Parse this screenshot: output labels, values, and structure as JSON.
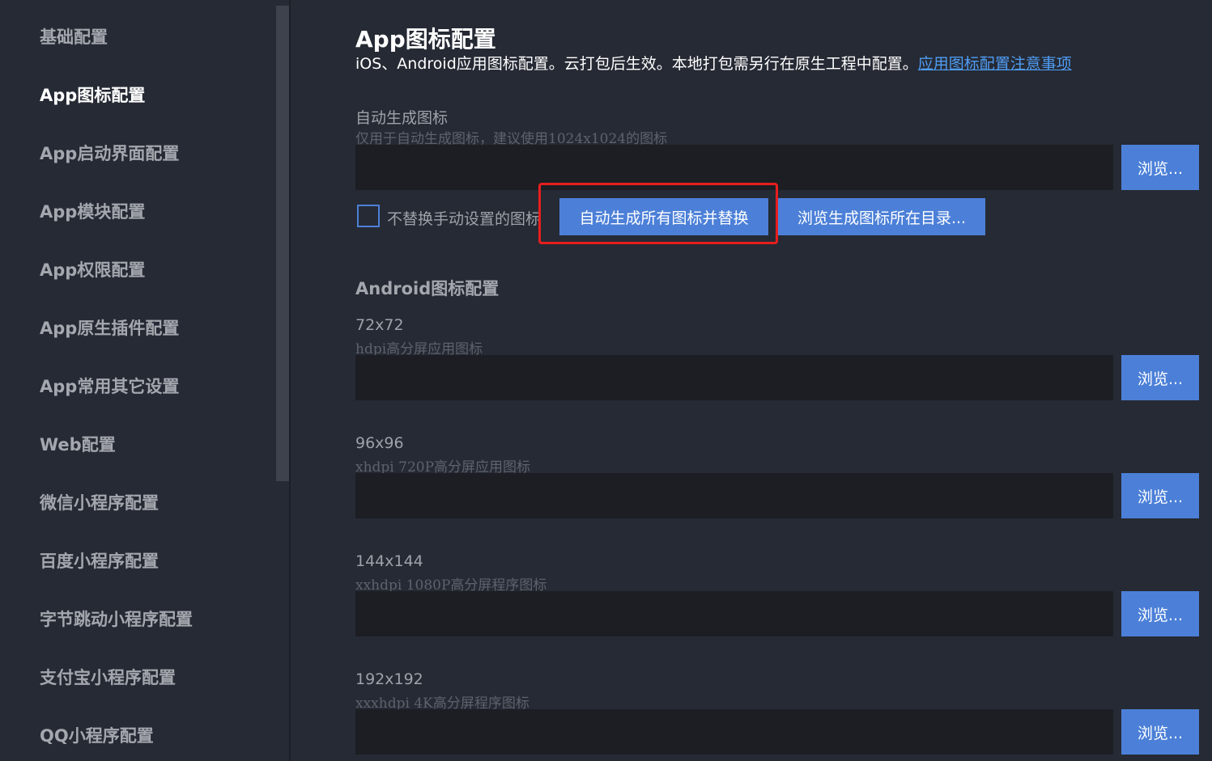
{
  "sidebar": {
    "items": [
      {
        "label": "基础配置",
        "active": false
      },
      {
        "label": "App图标配置",
        "active": true
      },
      {
        "label": "App启动界面配置",
        "active": false
      },
      {
        "label": "App模块配置",
        "active": false
      },
      {
        "label": "App权限配置",
        "active": false
      },
      {
        "label": "App原生插件配置",
        "active": false
      },
      {
        "label": "App常用其它设置",
        "active": false
      },
      {
        "label": "Web配置",
        "active": false
      },
      {
        "label": "微信小程序配置",
        "active": false
      },
      {
        "label": "百度小程序配置",
        "active": false
      },
      {
        "label": "字节跳动小程序配置",
        "active": false
      },
      {
        "label": "支付宝小程序配置",
        "active": false
      },
      {
        "label": "QQ小程序配置",
        "active": false
      }
    ]
  },
  "main": {
    "title": "App图标配置",
    "description": "iOS、Android应用图标配置。云打包后生效。本地打包需另行在原生工程中配置。",
    "description_link": "应用图标配置注意事项",
    "auto": {
      "label": "自动生成图标",
      "hint": "仅用于自动生成图标，建议使用1024x1024的图标",
      "value": "",
      "browse_label": "浏览...",
      "checkbox_label": "不替换手动设置的图标",
      "checkbox_checked": false,
      "generate_label": "自动生成所有图标并替换",
      "open_dir_label": "浏览生成图标所在目录..."
    },
    "android": {
      "section_title": "Android图标配置",
      "fields": [
        {
          "label": "72x72",
          "hint": "hdpi高分屏应用图标",
          "value": "",
          "browse_label": "浏览..."
        },
        {
          "label": "96x96",
          "hint": "xhdpi 720P高分屏应用图标",
          "value": "",
          "browse_label": "浏览..."
        },
        {
          "label": "144x144",
          "hint": "xxhdpi 1080P高分屏程序图标",
          "value": "",
          "browse_label": "浏览..."
        },
        {
          "label": "192x192",
          "hint": "xxxhdpi 4K高分屏程序图标",
          "value": "",
          "browse_label": "浏览..."
        }
      ]
    }
  },
  "colors": {
    "background": "#262a34",
    "input_bg": "#1c1e23",
    "accent": "#4c80d8",
    "link": "#4f9df5",
    "highlight": "#e81e1e"
  }
}
